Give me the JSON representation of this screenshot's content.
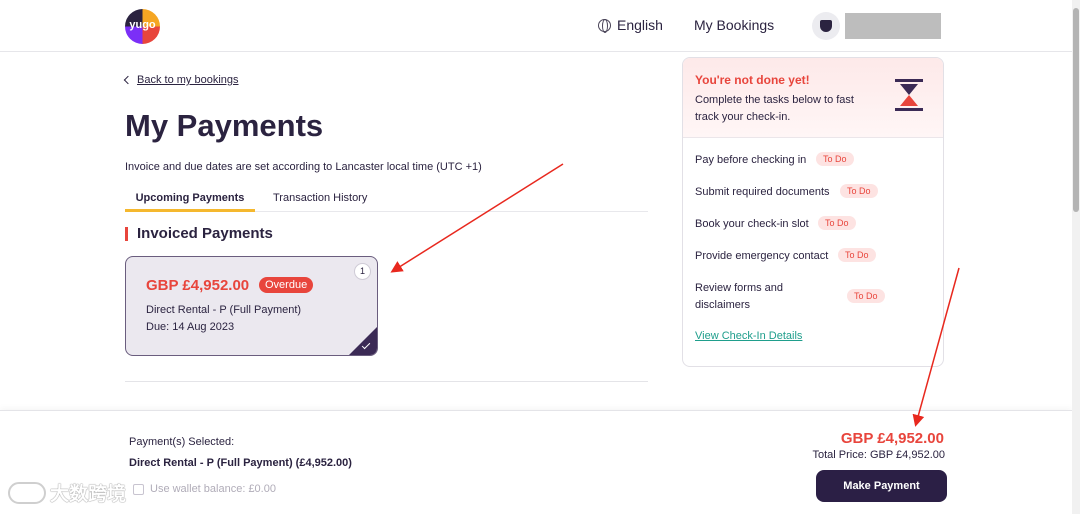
{
  "header": {
    "logo_text": "yugo",
    "language": "English",
    "my_bookings": "My Bookings"
  },
  "main": {
    "back_link": "Back to my bookings",
    "title": "My Payments",
    "timezone_note": "Invoice and due dates are set according to Lancaster local time (UTC +1)",
    "tabs": [
      {
        "label": "Upcoming Payments",
        "active": true
      },
      {
        "label": "Transaction History",
        "active": false
      }
    ],
    "section_title": "Invoiced Payments",
    "payment_card": {
      "amount": "GBP £4,952.00",
      "status": "Overdue",
      "name": "Direct Rental - P (Full Payment)",
      "due": "Due: 14 Aug 2023",
      "number": "1",
      "selected": true
    }
  },
  "checkin": {
    "heading": "You're not done yet!",
    "message": "Complete the tasks below to fast track your check-in.",
    "tasks": [
      {
        "label": "Pay before checking in",
        "status": "To Do"
      },
      {
        "label": "Submit required documents",
        "status": "To Do"
      },
      {
        "label": "Book your check-in slot",
        "status": "To Do"
      },
      {
        "label": "Provide emergency contact",
        "status": "To Do"
      },
      {
        "label": "Review forms and disclaimers",
        "status": "To Do"
      }
    ],
    "view_link": "View Check-In Details"
  },
  "footer": {
    "selected_label": "Payment(s) Selected:",
    "selected_value": "Direct Rental - P (Full Payment) (£4,952.00)",
    "wallet_label": "Use wallet balance: £0.00",
    "total_amount": "GBP £4,952.00",
    "total_price": "Total Price: GBP £4,952.00",
    "make_payment": "Make Payment"
  },
  "watermark": {
    "text": "大数跨境"
  },
  "colors": {
    "brand_dark": "#2b1f45",
    "accent_red": "#e8453c",
    "tab_underline": "#f5b82e",
    "link_green": "#1f9e8c"
  }
}
